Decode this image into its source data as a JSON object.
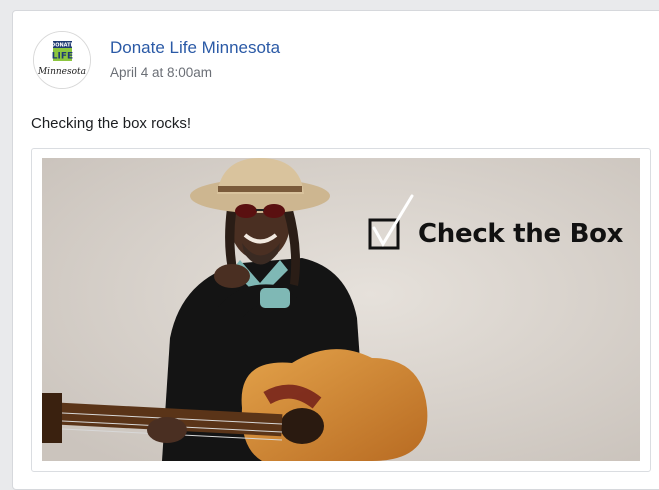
{
  "post": {
    "page_name": "Donate Life Minnesota",
    "timestamp": "April 4 at 8:00am",
    "text": "Checking the box rocks!"
  },
  "avatar": {
    "logo_top": "DONATE",
    "logo_main": "LIFE",
    "logo_script": "Minnesota"
  },
  "media": {
    "headline": "Check the Box",
    "icons": [
      "checkbox-icon",
      "checkmark-icon"
    ]
  },
  "colors": {
    "link_blue": "#2b5aa6",
    "logo_green": "#8cc63f",
    "logo_navy": "#1f3b73",
    "photo_background": "#d9d3cd"
  }
}
